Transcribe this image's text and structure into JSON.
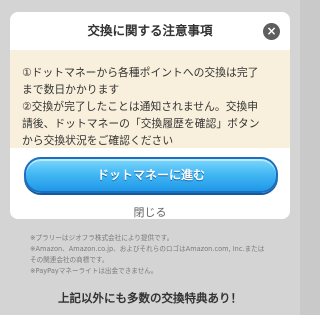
{
  "modal": {
    "title": "交換に関する注意事項",
    "close_icon": "close-icon",
    "notice_lines": [
      "①ドットマネーから各種ポイントへの交換は完了",
      "まで数日かかります",
      "②交換が完了したことは通知されません。交換申",
      "請後、ドットマネーの「交換履歴を確認」ボタン",
      "から交換状況をご確認ください"
    ],
    "primary_button": "ドットマネーに進む",
    "close_label": "閉じる"
  },
  "background": {
    "note_lines": [
      "※プラリーはジオフラ株式会社により提供です。",
      "※Amazon、Amazon.co.jp、およびそれらのロゴはAmazon.com, Inc.またはその関連会社の商標です。",
      "その関連会社の商標です。",
      "※PayPayマネーライトは出金できません。"
    ],
    "footer": "上記以外にも多数の交換特典あり！"
  },
  "colors": {
    "notice_bg": "#f8f0dc",
    "button_blue": "#45b9f4",
    "overlay": "#c9c9c9"
  }
}
